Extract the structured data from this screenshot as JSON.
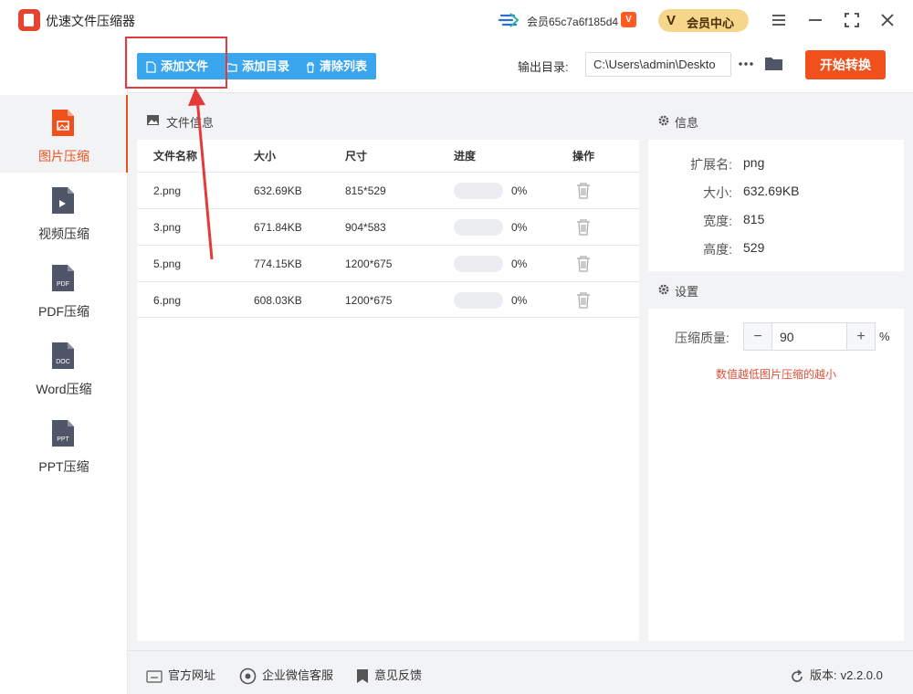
{
  "app": {
    "title": "优速文件压缩器",
    "member_id": "会员65c7a6f185d4",
    "vip_badge": "V",
    "member_center": "会员中心",
    "member_center_mark": "V"
  },
  "toolbar": {
    "add_file": "添加文件",
    "add_dir": "添加目录",
    "clear_list": "清除列表",
    "output_label": "输出目录:",
    "output_path": "C:\\Users\\admin\\Deskto",
    "start": "开始转换"
  },
  "sidebar": {
    "items": [
      {
        "label": "图片压缩",
        "icon": "image-file-icon",
        "active": true
      },
      {
        "label": "视频压缩",
        "icon": "video-file-icon",
        "active": false
      },
      {
        "label": "PDF压缩",
        "icon": "pdf-file-icon",
        "tag": "PDF",
        "active": false
      },
      {
        "label": "Word压缩",
        "icon": "doc-file-icon",
        "tag": "DOC",
        "active": false
      },
      {
        "label": "PPT压缩",
        "icon": "ppt-file-icon",
        "tag": "PPT",
        "active": false
      }
    ]
  },
  "file_panel": {
    "title": "文件信息",
    "columns": {
      "name": "文件名称",
      "size": "大小",
      "dims": "尺寸",
      "progress": "进度",
      "action": "操作"
    },
    "rows": [
      {
        "name": "2.png",
        "size": "632.69KB",
        "dims": "815*529",
        "progress": 0,
        "progress_text": "0%"
      },
      {
        "name": "3.png",
        "size": "671.84KB",
        "dims": "904*583",
        "progress": 0,
        "progress_text": "0%"
      },
      {
        "name": "5.png",
        "size": "774.15KB",
        "dims": "1200*675",
        "progress": 0,
        "progress_text": "0%"
      },
      {
        "name": "6.png",
        "size": "608.03KB",
        "dims": "1200*675",
        "progress": 0,
        "progress_text": "0%"
      }
    ]
  },
  "info": {
    "title": "信息",
    "ext_key": "扩展名:",
    "ext_val": "png",
    "size_key": "大小:",
    "size_val": "632.69KB",
    "width_key": "宽度:",
    "width_val": "815",
    "height_key": "高度:",
    "height_val": "529"
  },
  "settings": {
    "title": "设置",
    "quality_label": "压缩质量:",
    "quality_value": "90",
    "minus": "−",
    "plus": "+",
    "unit": "%",
    "hint": "数值越低图片压缩的越小"
  },
  "footer": {
    "site": "官方网址",
    "wechat": "企业微信客服",
    "feedback": "意见反馈",
    "version_label": "版本:",
    "version": "v2.2.0.0"
  },
  "colors": {
    "accent_blue": "#3aa6ed",
    "accent_orange": "#f0511c",
    "annotation_red": "#e33b3b"
  }
}
